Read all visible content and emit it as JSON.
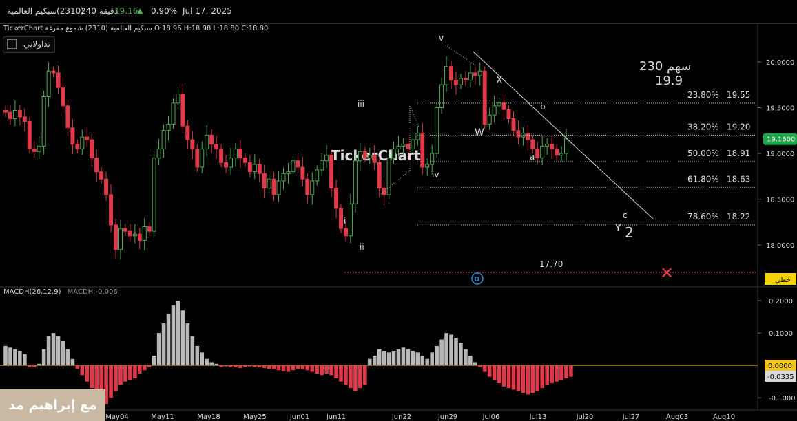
{
  "header": {
    "name": "سبكيم العالمية",
    "code": "(2310)",
    "interval": "240 دقيقة",
    "price": "19.16",
    "change_pct": "0.90%",
    "date": "Jul 17, 2025"
  },
  "legend": {
    "source": "TickerChart",
    "chart_desc": "سبكيم العالمية (2310) شموع مفرغة",
    "ohlc": "O:18.96  H:18.98  L:18.80  C:18.80"
  },
  "tadawul_label": "تداولاتي",
  "macd_legend": {
    "title": "MACDH(26,12,9)",
    "value": "MACDH:-0.006"
  },
  "watermark": "TickerChart",
  "author": "مع إبراهيم مد",
  "colors": {
    "up": "#4caf50",
    "down": "#e0394a",
    "macd_pos": "#b8b8b8",
    "macd_neg": "#e0394a",
    "price_badge": "#1fa64a",
    "zero_badge": "#f5c518"
  },
  "chart_data": [
    {
      "type": "candlestick",
      "y_ticks": [
        "20.0000",
        "19.5000",
        "19.0000",
        "18.5000",
        "18.0000"
      ],
      "ylim": [
        17.58,
        20.3
      ],
      "x_ticks": [
        "May04",
        "May11",
        "May18",
        "May25",
        "Jun01",
        "Jun11",
        "Jun22",
        "Jun29",
        "Jul06",
        "Jul13",
        "Jul20",
        "Jul27",
        "Aug03",
        "Aug10"
      ],
      "current_price_label": "19.1600",
      "fib_levels": [
        {
          "pct": "23.80%",
          "price": "19.55"
        },
        {
          "pct": "38.20%",
          "price": "19.20"
        },
        {
          "pct": "50.00%",
          "price": "18.91"
        },
        {
          "pct": "61.80%",
          "price": "18.63"
        },
        {
          "pct": "78.60%",
          "price": "18.22"
        }
      ],
      "support": {
        "value": "17.70",
        "tag": "خطي"
      },
      "target_note": {
        "line1": "230 سهم",
        "line2": "19.9"
      },
      "wave_labels": [
        "v",
        "iii",
        "iv",
        "i",
        "ii",
        "X",
        "W",
        "b",
        "a",
        "c",
        "Y",
        "2"
      ],
      "closes": [
        19.45,
        19.38,
        19.47,
        19.4,
        19.35,
        19.05,
        19.02,
        19.08,
        19.62,
        19.9,
        19.88,
        19.72,
        19.52,
        19.28,
        19.1,
        19.05,
        19.18,
        19.15,
        18.95,
        18.8,
        18.72,
        18.55,
        18.22,
        17.95,
        18.18,
        18.15,
        18.1,
        18.12,
        18.05,
        18.2,
        18.15,
        18.95,
        19.05,
        19.25,
        19.32,
        19.55,
        19.65,
        19.3,
        19.15,
        19.05,
        18.85,
        19.05,
        19.2,
        19.1,
        19.05,
        18.9,
        18.85,
        18.95,
        19.05,
        18.95,
        18.9,
        18.8,
        18.88,
        18.78,
        18.62,
        18.72,
        18.55,
        18.7,
        18.78,
        18.8,
        18.92,
        18.85,
        18.72,
        18.55,
        18.7,
        18.82,
        18.92,
        18.98,
        18.62,
        18.4,
        18.18,
        18.1,
        18.45,
        18.92,
        19.02,
        18.95,
        18.98,
        18.9,
        18.62,
        18.55,
        18.95,
        19.05,
        19.08,
        19.1,
        19.05,
        19.15,
        19.22,
        18.85,
        18.88,
        19.0,
        19.5,
        19.75,
        19.95,
        19.8,
        19.75,
        19.82,
        19.8,
        19.88,
        19.85,
        19.9,
        19.32,
        19.42,
        19.52,
        19.55,
        19.48,
        19.38,
        19.25,
        19.18,
        19.22,
        19.15,
        19.05,
        18.95,
        19.08,
        19.1,
        19.05,
        18.98,
        19.0,
        19.16
      ],
      "macd_values": [
        0.06,
        0.055,
        0.05,
        0.045,
        0.035,
        -0.005,
        -0.005,
        0.005,
        0.05,
        0.09,
        0.1,
        0.09,
        0.075,
        0.05,
        0.02,
        -0.01,
        -0.03,
        -0.05,
        -0.07,
        -0.09,
        -0.11,
        -0.12,
        -0.1,
        -0.08,
        -0.06,
        -0.05,
        -0.045,
        -0.04,
        -0.025,
        -0.015,
        -0.005,
        0.03,
        0.1,
        0.13,
        0.16,
        0.185,
        0.2,
        0.17,
        0.13,
        0.09,
        0.06,
        0.04,
        0.02,
        0.01,
        0.005,
        -0.005,
        -0.003,
        -0.005,
        -0.006,
        -0.008,
        -0.005,
        -0.003,
        -0.005,
        -0.006,
        -0.008,
        -0.01,
        -0.012,
        -0.015,
        -0.018,
        -0.02,
        -0.015,
        -0.01,
        -0.012,
        -0.015,
        -0.02,
        -0.025,
        -0.03,
        -0.025,
        -0.03,
        -0.04,
        -0.05,
        -0.06,
        -0.07,
        -0.08,
        -0.07,
        -0.06,
        0.02,
        0.03,
        0.05,
        0.045,
        0.04,
        0.045,
        0.05,
        0.055,
        0.05,
        0.045,
        0.04,
        0.03,
        0.02,
        0.04,
        0.06,
        0.08,
        0.1,
        0.095,
        0.085,
        0.07,
        0.05,
        0.03,
        0.01,
        -0.005,
        -0.02,
        -0.035,
        -0.045,
        -0.055,
        -0.065,
        -0.07,
        -0.075,
        -0.08,
        -0.085,
        -0.09,
        -0.085,
        -0.08,
        -0.07,
        -0.06,
        -0.055,
        -0.05,
        -0.045,
        -0.04,
        -0.035
      ],
      "macd_y_ticks": [
        "0.2000",
        "0.1000",
        "-0.1000"
      ],
      "macd_ylim": [
        -0.125,
        0.215
      ],
      "macd_zero_label": "0.0000",
      "macd_last_label": "-0.0335"
    }
  ]
}
